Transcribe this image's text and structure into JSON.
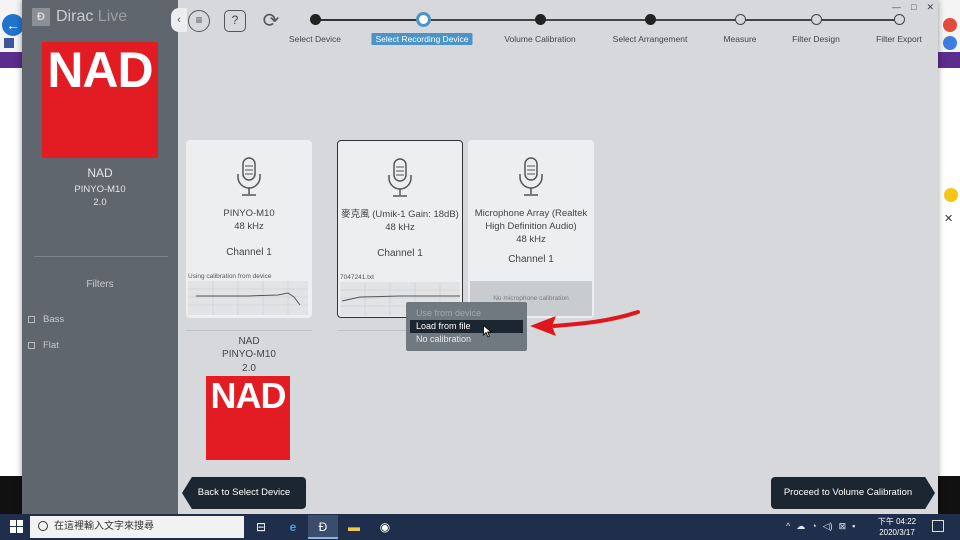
{
  "app": {
    "title": "Dirac Live",
    "logo_letter": "Ð",
    "brand_name": "Dirac",
    "brand_suffix": "Live"
  },
  "sidebar": {
    "device_logo": "NAD",
    "device_brand": "NAD",
    "device_model": "PINYO-M10",
    "device_channels": "2.0",
    "filters_title": "Filters",
    "filters": [
      {
        "label": "Bass"
      },
      {
        "label": "Flat"
      }
    ]
  },
  "toolbar": {
    "collapse_icon": "‹",
    "menu_icon": "≡",
    "help_icon": "?",
    "refresh_icon": "⟳"
  },
  "window_controls": {
    "minimize": "—",
    "maximize": "□",
    "close": "✕"
  },
  "steps": [
    {
      "label": "Select Device",
      "state": "done"
    },
    {
      "label": "Select Recording Device",
      "state": "current"
    },
    {
      "label": "Volume Calibration",
      "state": "done"
    },
    {
      "label": "Select Arrangement",
      "state": "done"
    },
    {
      "label": "Measure",
      "state": "todo"
    },
    {
      "label": "Filter Design",
      "state": "todo"
    },
    {
      "label": "Filter Export",
      "state": "todo"
    }
  ],
  "recording_devices": [
    {
      "name": "PINYO-M10",
      "rate": "48 kHz",
      "channel": "Channel 1",
      "calibration": "Using calibration from device"
    },
    {
      "name": "麥克風 (Umik-1  Gain: 18dB)",
      "rate": "48 kHz",
      "channel": "Channel 1",
      "calibration": "7047241.txt"
    },
    {
      "name": "Microphone Array (Realtek High Definition Audio)",
      "rate": "48 kHz",
      "channel": "Channel 1",
      "calibration": "No microphone calibration"
    }
  ],
  "output_device": {
    "logo": "NAD",
    "brand": "NAD",
    "model": "PINYO-M10",
    "channels": "2.0"
  },
  "calibration_menu": {
    "items": [
      {
        "label": "Use from device",
        "state": "disabled"
      },
      {
        "label": "Load from file",
        "state": "hover"
      },
      {
        "label": "No calibration",
        "state": "normal"
      }
    ]
  },
  "buttons": {
    "back": "Back to Select Device",
    "proceed": "Proceed to Volume Calibration"
  },
  "taskbar": {
    "search_placeholder": "在這裡輸入文字來搜尋",
    "time": "下午 04:22",
    "date": "2020/3/17",
    "apps": [
      "task-view-icon",
      "edge-icon",
      "dirac-icon",
      "file-explorer-icon",
      "obs-icon"
    ]
  },
  "colors": {
    "accent": "#4b93c9",
    "nad_red": "#e31b23",
    "sidebar": "#5f666d",
    "button_dark": "#1c2631",
    "arrow_red": "#e0161d"
  }
}
